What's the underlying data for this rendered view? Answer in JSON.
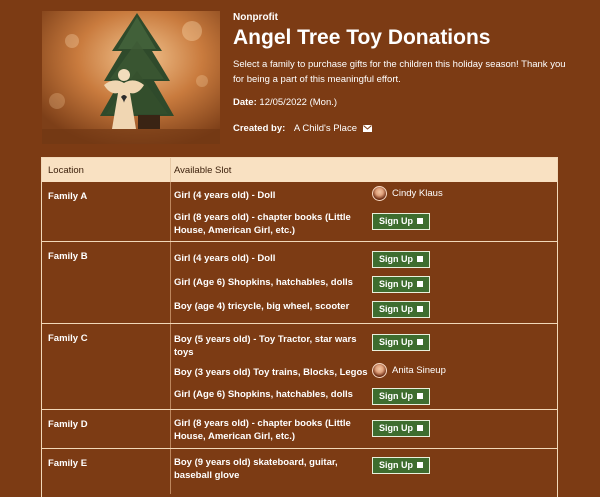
{
  "header": {
    "category": "Nonprofit",
    "title": "Angel Tree Toy Donations",
    "description": "Select a family to purchase gifts for the children this holiday season! Thank you for being a part of this meaningful effort.",
    "date_label": "Date:",
    "date_value": "12/05/2022 (Mon.)",
    "created_by_label": "Created by:",
    "created_by_value": "A Child's Place",
    "mail_icon": "envelope-icon"
  },
  "table": {
    "col_location": "Location",
    "col_slot": "Available Slot",
    "signup_label": "Sign Up",
    "families": [
      {
        "name": "Family A",
        "slots": [
          {
            "text": "Girl (4 years old) - Doll",
            "taken_by": "Cindy Klaus"
          },
          {
            "text": "Girl (8 years old) - chapter books (Little House, American Girl, etc.)",
            "taken_by": null
          }
        ]
      },
      {
        "name": "Family B",
        "slots": [
          {
            "text": "Girl (4 years old) - Doll",
            "taken_by": null
          },
          {
            "text": "Girl (Age 6) Shopkins, hatchables, dolls",
            "taken_by": null
          },
          {
            "text": "Boy (age 4) tricycle, big wheel, scooter",
            "taken_by": null
          }
        ]
      },
      {
        "name": "Family C",
        "slots": [
          {
            "text": "Boy (5 years old) - Toy Tractor, star wars toys",
            "taken_by": null
          },
          {
            "text": "Boy (3 years old) Toy trains, Blocks, Legos",
            "taken_by": "Anita Sineup"
          },
          {
            "text": "Girl (Age 6) Shopkins, hatchables, dolls",
            "taken_by": null
          }
        ]
      },
      {
        "name": "Family D",
        "slots": [
          {
            "text": "Girl (8 years old) - chapter books (Little House, American Girl, etc.)",
            "taken_by": null
          }
        ]
      },
      {
        "name": "Family E",
        "slots": [
          {
            "text": "Boy (9 years old) skateboard, guitar, baseball glove",
            "taken_by": null
          }
        ]
      }
    ]
  },
  "colors": {
    "page_background": "#7c3b14",
    "table_header": "#f9e1c2",
    "signup_button": "#3e6d2f"
  }
}
